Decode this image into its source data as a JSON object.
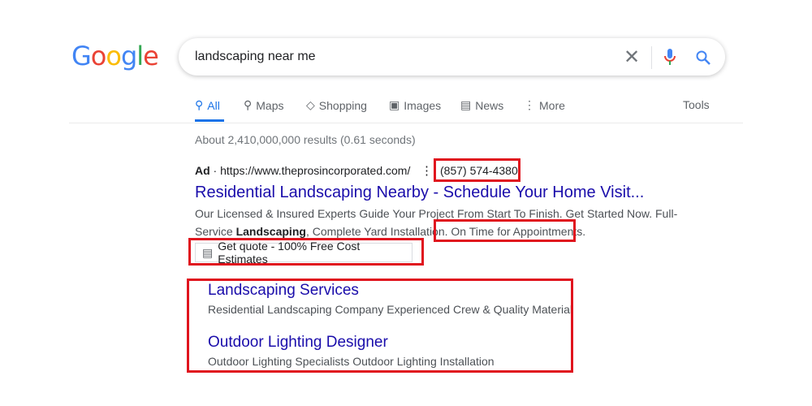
{
  "logo": "Google",
  "search": {
    "query": "landscaping near me"
  },
  "tabs": [
    {
      "label": "All",
      "icon": "search-icon"
    },
    {
      "label": "Maps",
      "icon": "pin-icon"
    },
    {
      "label": "Shopping",
      "icon": "tag-icon"
    },
    {
      "label": "Images",
      "icon": "image-icon"
    },
    {
      "label": "News",
      "icon": "news-icon"
    },
    {
      "label": "More",
      "icon": "dots-icon"
    }
  ],
  "tools": "Tools",
  "stats": "About 2,410,000,000 results (0.61 seconds)",
  "ad": {
    "badge": "Ad",
    "url": "https://www.theprosincorporated.com/",
    "phone": "(857) 574-4380",
    "title": "Residential Landscaping Nearby - Schedule Your Home Visit...",
    "desc1": "Our Licensed & Insured Experts Guide Your Project From Start To Finish. Get Started Now. Full-",
    "desc2a": "Service ",
    "desc2b": "Landscaping",
    "desc2c": ", Complete Yard Installation. ",
    "desc2d": "On Time for Appointments.",
    "quote": "Get quote - 100% Free Cost Estimates",
    "sitelinks": [
      {
        "title": "Landscaping Services",
        "desc": "Residential Landscaping Company Experienced Crew & Quality Material"
      },
      {
        "title": "Outdoor Lighting Designer",
        "desc": "Outdoor Lighting Specialists Outdoor Lighting Installation"
      }
    ]
  },
  "colors": {
    "link": "#1a0dab",
    "highlight": "#e0141e",
    "accent": "#1a73e8"
  }
}
